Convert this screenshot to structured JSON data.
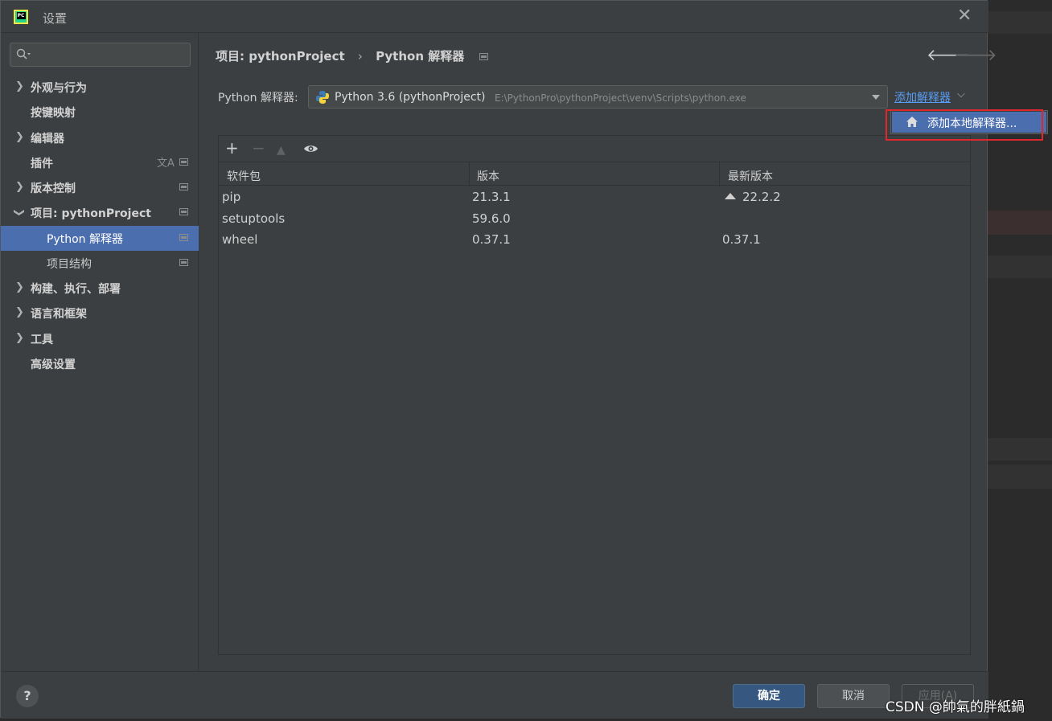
{
  "window": {
    "title": "设置"
  },
  "sidebar": {
    "search_placeholder": "",
    "items": [
      {
        "label": "外观与行为",
        "expandable": true
      },
      {
        "label": "按键映射"
      },
      {
        "label": "编辑器",
        "expandable": true
      },
      {
        "label": "插件"
      },
      {
        "label": "版本控制",
        "expandable": true
      },
      {
        "label": "项目: pythonProject",
        "expanded": true
      },
      {
        "label": "Python 解释器",
        "selected": true
      },
      {
        "label": "项目结构"
      },
      {
        "label": "构建、执行、部署",
        "expandable": true
      },
      {
        "label": "语言和框架",
        "expandable": true
      },
      {
        "label": "工具",
        "expandable": true
      },
      {
        "label": "高级设置"
      }
    ]
  },
  "breadcrumb": {
    "project": "项目: pythonProject",
    "page": "Python 解释器"
  },
  "interpreter": {
    "label": "Python 解释器:",
    "name": "Python 3.6 (pythonProject)",
    "path": "E:\\PythonPro\\pythonProject\\venv\\Scripts\\python.exe",
    "add_link": "添加解释器"
  },
  "popup": {
    "item_label": "添加本地解释器..."
  },
  "packages": {
    "columns": [
      "软件包",
      "版本",
      "最新版本"
    ],
    "rows": [
      {
        "name": "pip",
        "version": "21.3.1",
        "latest": "22.2.2",
        "upgrade": true
      },
      {
        "name": "setuptools",
        "version": "59.6.0",
        "latest": ""
      },
      {
        "name": "wheel",
        "version": "0.37.1",
        "latest": "0.37.1"
      }
    ]
  },
  "footer": {
    "help": "?",
    "ok": "确定",
    "cancel": "取消",
    "apply": "应用(A)"
  },
  "watermark": "CSDN @帥氣的胖紙鍋",
  "colors": {
    "accent": "#4b6eaf",
    "link": "#589df6",
    "highlight_box": "#e0272d",
    "background": "#3c3f41"
  }
}
